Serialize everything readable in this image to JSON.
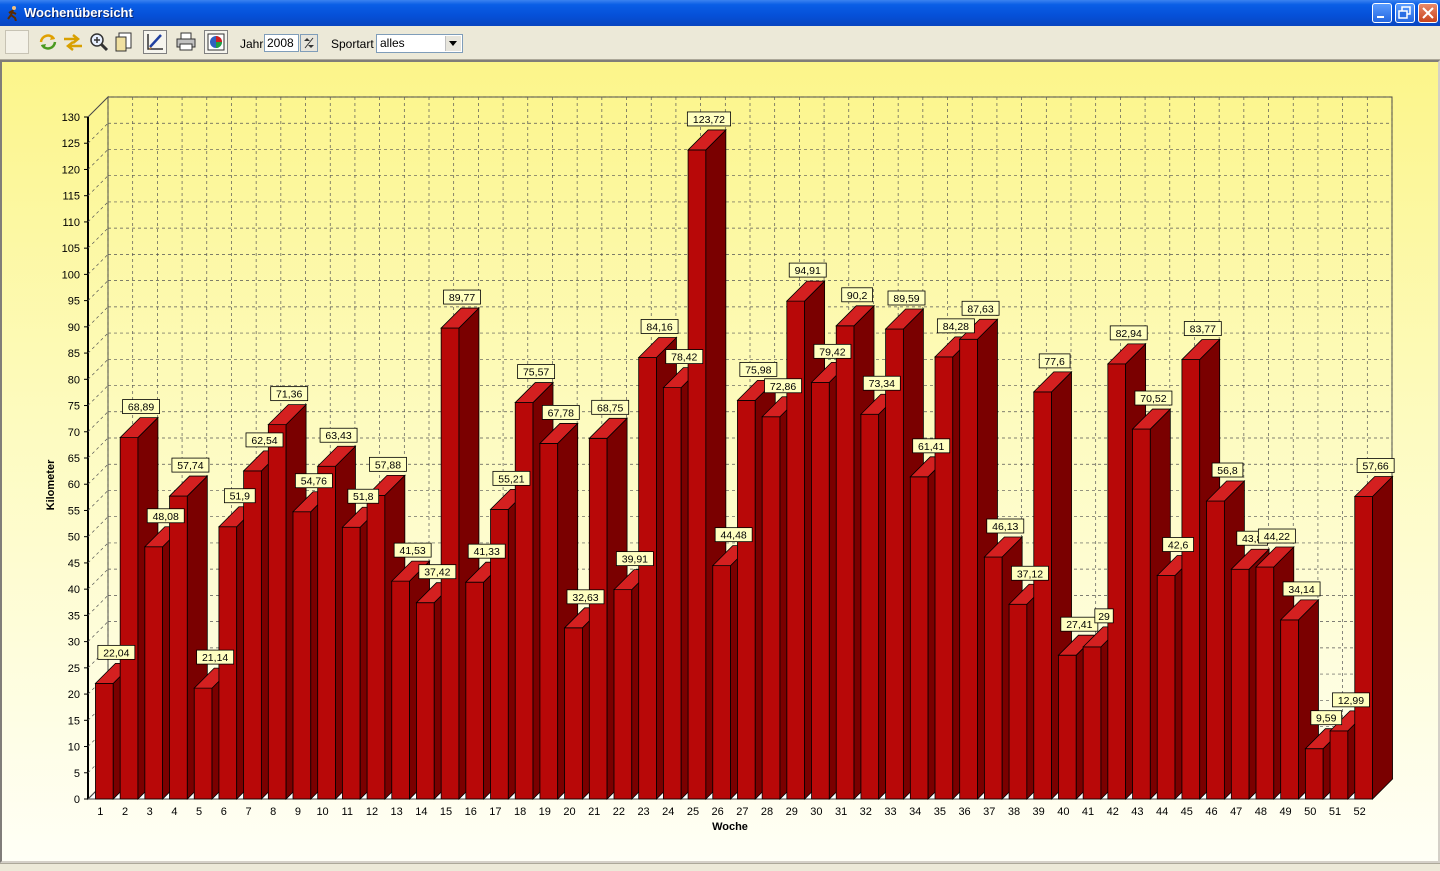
{
  "window": {
    "title": "Wochenübersicht",
    "icon": "runner-icon"
  },
  "toolbar": {
    "buttons": [
      "blank-icon",
      "refresh-icon",
      "swap-arrows-icon",
      "zoom-icon",
      "copy-icon",
      "edit-chart-icon",
      "print-icon",
      "palette-icon"
    ],
    "year_label": "Jahr",
    "year_value": "2008",
    "sport_label": "Sportart",
    "sport_value": "alles"
  },
  "colors": {
    "bar_front": "#b80808",
    "bar_side": "#7a0000",
    "bar_top": "#d42020",
    "label_bg": "#ffffc0",
    "grid": "#555555"
  },
  "chart_data": {
    "type": "bar",
    "xlabel": "Woche",
    "ylabel": "Kilometer",
    "ylim": [
      0,
      130
    ],
    "ytick_step": 5,
    "grid": true,
    "categories": [
      "1",
      "2",
      "3",
      "4",
      "5",
      "6",
      "7",
      "8",
      "9",
      "10",
      "11",
      "12",
      "13",
      "14",
      "15",
      "16",
      "17",
      "18",
      "19",
      "20",
      "21",
      "22",
      "23",
      "24",
      "25",
      "26",
      "27",
      "28",
      "29",
      "30",
      "31",
      "32",
      "33",
      "34",
      "35",
      "36",
      "37",
      "38",
      "39",
      "40",
      "41",
      "42",
      "43",
      "44",
      "45",
      "46",
      "47",
      "48",
      "49",
      "50",
      "51",
      "52"
    ],
    "values": [
      22.04,
      68.89,
      48.08,
      57.74,
      21.14,
      51.9,
      62.54,
      71.36,
      54.76,
      63.43,
      51.8,
      57.88,
      41.53,
      37.42,
      89.77,
      41.33,
      55.21,
      75.57,
      67.78,
      32.63,
      68.75,
      39.91,
      84.16,
      78.42,
      123.72,
      44.48,
      75.98,
      72.86,
      94.91,
      79.42,
      90.2,
      73.34,
      89.59,
      61.41,
      84.28,
      87.63,
      46.13,
      37.12,
      77.6,
      27.41,
      29,
      82.94,
      70.52,
      42.6,
      83.77,
      56.8,
      43.8,
      44.22,
      34.14,
      9.59,
      12.99,
      57.66
    ],
    "data_labels": [
      "22,04",
      "68,89",
      "48,08",
      "57,74",
      "21,14",
      "51,9",
      "62,54",
      "71,36",
      "54,76",
      "63,43",
      "51,8",
      "57,88",
      "41,53",
      "37,42",
      "89,77",
      "41,33",
      "55,21",
      "75,57",
      "67,78",
      "32,63",
      "68,75",
      "39,91",
      "84,16",
      "78,42",
      "123,72",
      "44,48",
      "75,98",
      "72,86",
      "94,91",
      "79,42",
      "90,2",
      "73,34",
      "89,59",
      "61,41",
      "84,28",
      "87,63",
      "46,13",
      "37,12",
      "77,6",
      "27,41",
      "29",
      "82,94",
      "70,52",
      "42,6",
      "83,77",
      "56,8",
      "43,8",
      "44,22",
      "34,14",
      "9,59",
      "12,99",
      "57,66"
    ]
  }
}
